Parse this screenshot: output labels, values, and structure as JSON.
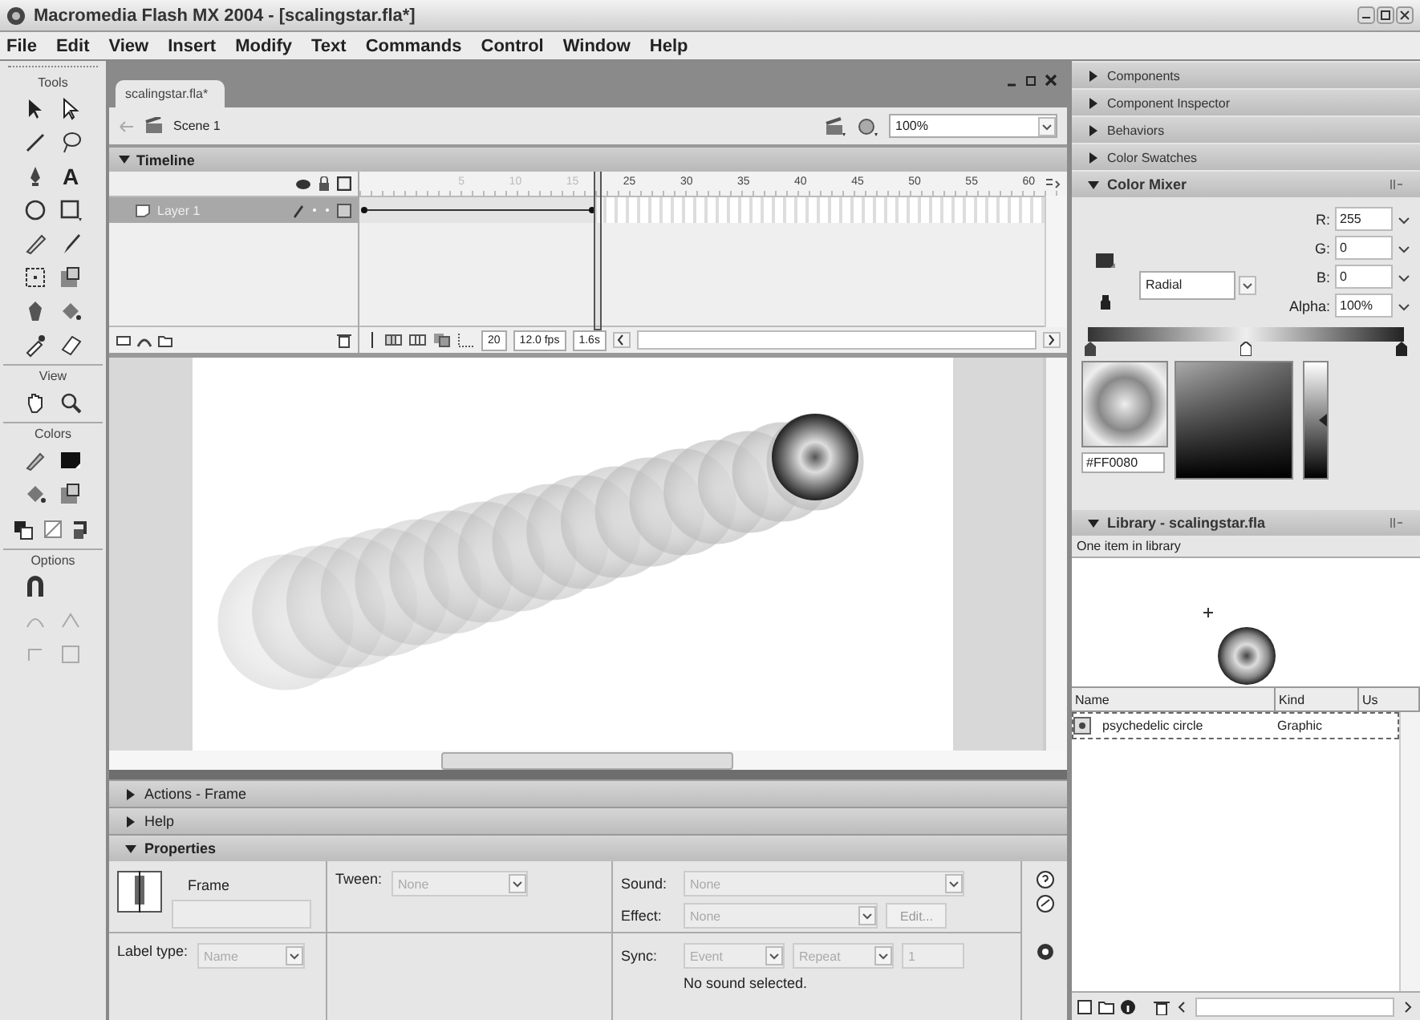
{
  "window": {
    "title": "Macromedia Flash MX 2004 - [scalingstar.fla*]"
  },
  "menu": [
    "File",
    "Edit",
    "View",
    "Insert",
    "Modify",
    "Text",
    "Commands",
    "Control",
    "Window",
    "Help"
  ],
  "tools": {
    "title": "Tools",
    "text_tool": "A",
    "sections": [
      "View",
      "Colors",
      "Options"
    ]
  },
  "document": {
    "tab": "scalingstar.fla*",
    "scene": "Scene 1",
    "zoom": "100%"
  },
  "timeline": {
    "title": "Timeline",
    "expanded": true,
    "ruler": [
      "5",
      "10",
      "15",
      "25",
      "30",
      "35",
      "40",
      "45",
      "50",
      "55",
      "60"
    ],
    "layers": [
      {
        "name": "Layer 1",
        "selected": true
      }
    ],
    "frame": "20",
    "fps": "12.0 fps",
    "time": "1.6s"
  },
  "panels": [
    {
      "title": "Actions - Frame",
      "expanded": false
    },
    {
      "title": "Help",
      "expanded": false
    },
    {
      "title": "Properties",
      "expanded": true
    }
  ],
  "properties": {
    "frame_label": "Frame",
    "tween_label": "Tween:",
    "tween": "None",
    "sound_label": "Sound:",
    "sound": "None",
    "effect_label": "Effect:",
    "effect": "None",
    "edit_button": "Edit...",
    "label_type_label": "Label type:",
    "label_type": "Name",
    "sync_label": "Sync:",
    "sync": "Event",
    "repeat": "Repeat",
    "repeat_count": "1",
    "sound_note": "No sound selected."
  },
  "side_panels": [
    {
      "title": "Components",
      "expanded": false
    },
    {
      "title": "Component Inspector",
      "expanded": false
    },
    {
      "title": "Behaviors",
      "expanded": false
    },
    {
      "title": "Color Swatches",
      "expanded": false
    },
    {
      "title": "Color Mixer",
      "expanded": true
    }
  ],
  "color_mixer": {
    "fill_type": "Radial",
    "channels": [
      {
        "label": "R:",
        "value": "255"
      },
      {
        "label": "G:",
        "value": "0"
      },
      {
        "label": "B:",
        "value": "0"
      },
      {
        "label": "Alpha:",
        "value": "100%"
      }
    ],
    "hex": "#FF0080",
    "brightness": {
      "level": 0.5
    }
  },
  "library": {
    "title": "Library - scalingstar.fla",
    "count": "One item in library",
    "expanded": true,
    "columns": [
      "Name",
      "Kind",
      "Us"
    ],
    "rows": [
      {
        "name": "psychedelic circle",
        "kind": "Graphic",
        "selected": true
      }
    ]
  }
}
